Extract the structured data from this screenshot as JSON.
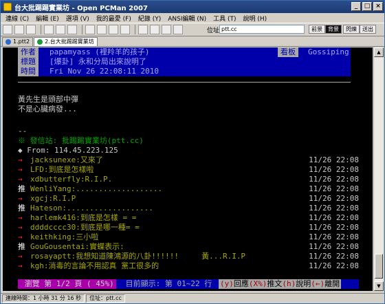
{
  "window": {
    "title": "台大批踢踢實業坊 - Open PCMan 2007",
    "controls": [
      "_",
      "□",
      "×"
    ]
  },
  "menu": [
    "連線 (C)",
    "編輯 (E)",
    "選項 (V)",
    "我的最愛 (F)",
    "紀錄 (Y)",
    "ANSI編輯 (N)",
    "工具 (T)",
    "說明 (H)"
  ],
  "toolbar": {
    "address_label": "位址：",
    "address_value": "ptt.cc",
    "buttons": [
      "前景",
      "背景",
      "閃爍",
      "送出"
    ]
  },
  "tabs": [
    {
      "label": "1.ptt2"
    },
    {
      "label": "2.台大批踢踢實業坊"
    }
  ],
  "article": {
    "author_label": "作者",
    "author": "papamyass (裡羚羊的孩子)",
    "board_label": "看板",
    "board": "Gossiping",
    "title_label": "標題",
    "title": "[爆卦] 永和分局出來說明了",
    "time_label": "時間",
    "time": "Fri Nov 26 22:08:11 2010",
    "body": [
      "黃先生是頭部中彈",
      "不是心臟病發..."
    ],
    "sig_dash": "--",
    "origin": "※ 發信站: 批踢踢實業坊(ptt.cc)",
    "from": "◆ From: 114.45.223.125"
  },
  "pushes": [
    {
      "tag": "→",
      "user": "jacksunexe",
      "msg": ":又來了",
      "time": "11/26 22:08"
    },
    {
      "tag": "→",
      "user": "LFD",
      "msg": ":到底是怎樣啦",
      "time": "11/26 22:08"
    },
    {
      "tag": "→",
      "user": "xdbutterfly",
      "msg": ":R.I.P.",
      "time": "11/26 22:08"
    },
    {
      "tag": "推",
      "user": "WenliYang",
      "msg": ":...................",
      "time": "11/26 22:08"
    },
    {
      "tag": "→",
      "user": "xgcj",
      "msg": ":R.I.P",
      "time": "11/26 22:08"
    },
    {
      "tag": "推",
      "user": "Hateson",
      "msg": ":...................",
      "time": "11/26 22:08"
    },
    {
      "tag": "→",
      "user": "harlemk416",
      "msg": ":到底是怎樣 = =",
      "time": "11/26 22:08"
    },
    {
      "tag": "→",
      "user": "ddddcccc30",
      "msg": ":到底是哪一種= =",
      "time": "11/26 22:08"
    },
    {
      "tag": "→",
      "user": "keithking",
      "msg": ":三小啦",
      "time": "11/26 22:08"
    },
    {
      "tag": "推",
      "user": "GouGousentai",
      "msg": ":實蝶表示:",
      "time": "11/26 22:08"
    },
    {
      "tag": "→",
      "user": "rosayaptt",
      "msg": ":我想知道陳鴻源的八卦!!!!!!     黃...R.I.P",
      "time": "11/26 22:08"
    },
    {
      "tag": "→",
      "user": "kgh",
      "msg": ":消毒的言論不用認真 黨工很多的",
      "time": "11/26 22:08"
    }
  ],
  "footer": {
    "progress": " 瀏覽 第 1/2 頁 ( 45%)",
    "lines": " 目前顯示: 第 01~22 行",
    "k1": "(y)",
    "t1": "回應",
    "k2": "(X%)",
    "t2": "推文",
    "k3": "(h)",
    "t3": "說明",
    "k4": "(←)",
    "t4": "離開"
  },
  "status": {
    "connected": "連線時間：1 小時 31 分 16 秒",
    "host": "位址：ptt.cc"
  },
  "colors": {
    "header_bg": "#0000aa",
    "label_bg": "#a8a8a8",
    "footer_progress_bg": "#a800a8",
    "arrow": "#ff3030",
    "user": "#a8a800",
    "body": "#c8c8c8"
  }
}
